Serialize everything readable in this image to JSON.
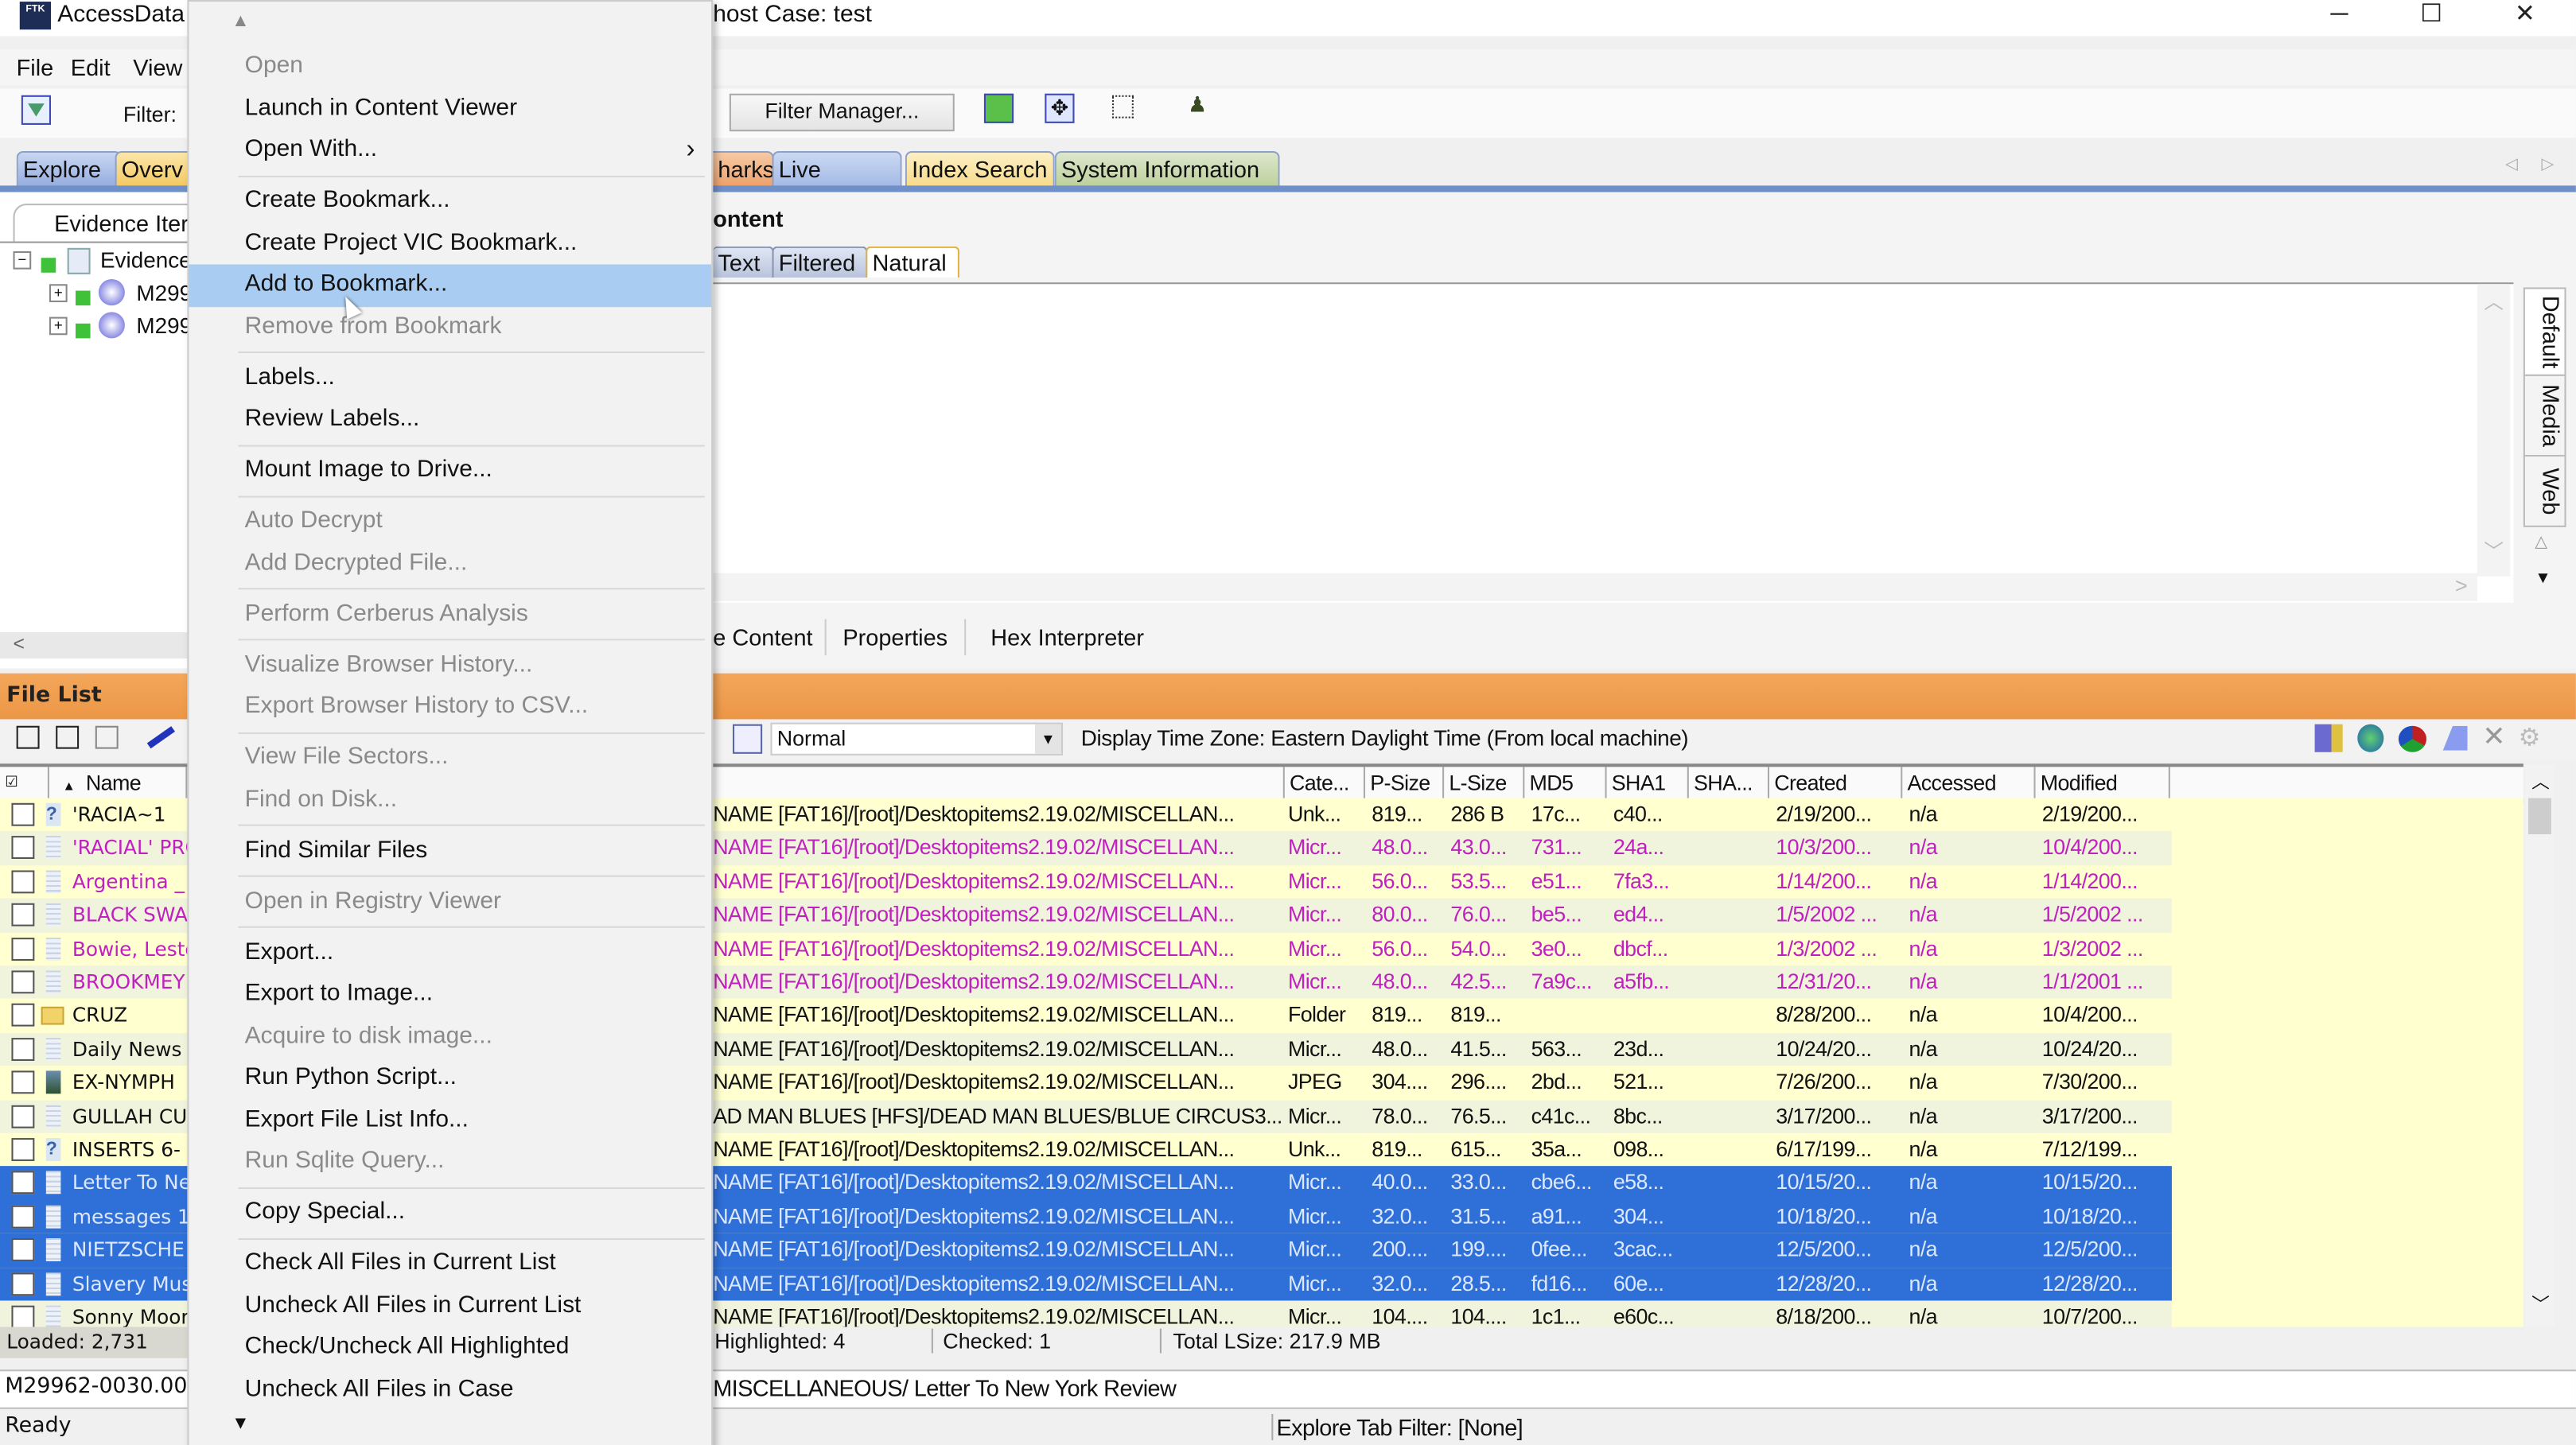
{
  "window": {
    "app_title": "AccessData",
    "case_title": "host Case: test",
    "minimize": "─",
    "maximize": "☐",
    "close": "✕"
  },
  "menubar": {
    "file": "File",
    "edit": "Edit",
    "view": "View"
  },
  "toolbar": {
    "filter_label": "Filter:",
    "filter_manager": "Filter Manager..."
  },
  "main_tabs": [
    {
      "label": "Explore",
      "color": "#a9bde6"
    },
    {
      "label": "Overv",
      "color": "#f7d680"
    },
    {
      "label": "harks",
      "color": "#f0b383"
    },
    {
      "label": "Live Search",
      "color": "#b3c6ea"
    },
    {
      "label": "Index Search",
      "color": "#f9e3a0"
    },
    {
      "label": "System Information",
      "color": "#c9d8ae"
    }
  ],
  "left_pane": {
    "tab": "Evidence Iter",
    "tree": [
      {
        "label": "Evidence"
      },
      {
        "label": "M299"
      },
      {
        "label": "M299"
      }
    ]
  },
  "content_pane": {
    "title": "ontent",
    "subtabs": [
      "Text",
      "Filtered",
      "Natural"
    ],
    "side_tabs": [
      "Default",
      "Media",
      "Web"
    ],
    "bottom_tabs": [
      "e Content",
      "Properties",
      "Hex Interpreter"
    ]
  },
  "file_list": {
    "title": "File List",
    "view_select": "Normal",
    "timezone": "Display Time Zone: Eastern Daylight Time  (From local machine)",
    "columns": {
      "name": "Name",
      "cat": "Cate...",
      "psize": "P-Size",
      "lsize": "L-Size",
      "md5": "MD5",
      "sha1": "SHA1",
      "sha": "SHA...",
      "created": "Created",
      "accessed": "Accessed",
      "modified": "Modified"
    },
    "rows": [
      {
        "name": "'RACIA~1",
        "icon": "unknown",
        "color": "black",
        "path": "NAME [FAT16]/[root]/Desktopitems2.19.02/MISCELLAN...",
        "cat": "Unk...",
        "psize": "819...",
        "lsize": "286 B",
        "md5": "17c...",
        "sha1": "c40...",
        "created": "2/19/200...",
        "accessed": "n/a",
        "modified": "2/19/200..."
      },
      {
        "name": "'RACIAL' PRO",
        "icon": "doc",
        "color": "magenta",
        "path": "NAME [FAT16]/[root]/Desktopitems2.19.02/MISCELLAN...",
        "cat": "Micr...",
        "psize": "48.0...",
        "lsize": "43.0...",
        "md5": "731...",
        "sha1": "24a...",
        "created": "10/3/200...",
        "accessed": "n/a",
        "modified": "10/4/200..."
      },
      {
        "name": "Argentina _",
        "icon": "doc",
        "color": "magenta",
        "path": "NAME [FAT16]/[root]/Desktopitems2.19.02/MISCELLAN...",
        "cat": "Micr...",
        "psize": "56.0...",
        "lsize": "53.5...",
        "md5": "e51...",
        "sha1": "7fa3...",
        "created": "1/14/200...",
        "accessed": "n/a",
        "modified": "1/14/200..."
      },
      {
        "name": "BLACK SWA",
        "icon": "doc",
        "color": "magenta",
        "path": "NAME [FAT16]/[root]/Desktopitems2.19.02/MISCELLAN...",
        "cat": "Micr...",
        "psize": "80.0...",
        "lsize": "76.0...",
        "md5": "be5...",
        "sha1": "ed4...",
        "created": "1/5/2002 ...",
        "accessed": "n/a",
        "modified": "1/5/2002 ..."
      },
      {
        "name": "Bowie, Leste",
        "icon": "doc",
        "color": "magenta",
        "path": "NAME [FAT16]/[root]/Desktopitems2.19.02/MISCELLAN...",
        "cat": "Micr...",
        "psize": "56.0...",
        "lsize": "54.0...",
        "md5": "3e0...",
        "sha1": "dbcf...",
        "created": "1/3/2002 ...",
        "accessed": "n/a",
        "modified": "1/3/2002 ..."
      },
      {
        "name": "BROOKMEY",
        "icon": "doc",
        "color": "magenta",
        "path": "NAME [FAT16]/[root]/Desktopitems2.19.02/MISCELLAN...",
        "cat": "Micr...",
        "psize": "48.0...",
        "lsize": "42.5...",
        "md5": "7a9c...",
        "sha1": "a5fb...",
        "created": "12/31/20...",
        "accessed": "n/a",
        "modified": "1/1/2001 ..."
      },
      {
        "name": "CRUZ",
        "icon": "folder",
        "color": "black",
        "path": "NAME [FAT16]/[root]/Desktopitems2.19.02/MISCELLAN...",
        "cat": "Folder",
        "psize": "819...",
        "lsize": "819...",
        "md5": "",
        "sha1": "",
        "created": "8/28/200...",
        "accessed": "n/a",
        "modified": "10/4/200..."
      },
      {
        "name": "Daily News",
        "icon": "doc",
        "color": "black",
        "path": "NAME [FAT16]/[root]/Desktopitems2.19.02/MISCELLAN...",
        "cat": "Micr...",
        "psize": "48.0...",
        "lsize": "41.5...",
        "md5": "563...",
        "sha1": "23d...",
        "created": "10/24/20...",
        "accessed": "n/a",
        "modified": "10/24/20..."
      },
      {
        "name": "EX-NYMPH",
        "icon": "image",
        "color": "black",
        "path": "NAME [FAT16]/[root]/Desktopitems2.19.02/MISCELLAN...",
        "cat": "JPEG",
        "psize": "304....",
        "lsize": "296....",
        "md5": "2bd...",
        "sha1": "521...",
        "created": "7/26/200...",
        "accessed": "n/a",
        "modified": "7/30/200..."
      },
      {
        "name": "GULLAH CU",
        "icon": "doc",
        "color": "black",
        "path": "AD MAN BLUES [HFS]/DEAD MAN BLUES/BLUE CIRCUS3...",
        "cat": "Micr...",
        "psize": "78.0...",
        "lsize": "76.5...",
        "md5": "c41c...",
        "sha1": "8bc...",
        "created": "3/17/200...",
        "accessed": "n/a",
        "modified": "3/17/200..."
      },
      {
        "name": "INSERTS 6-",
        "icon": "unknown",
        "color": "black",
        "path": "NAME [FAT16]/[root]/Desktopitems2.19.02/MISCELLAN...",
        "cat": "Unk...",
        "psize": "819...",
        "lsize": "615...",
        "md5": "35a...",
        "sha1": "098...",
        "created": "6/17/199...",
        "accessed": "n/a",
        "modified": "7/12/199..."
      },
      {
        "name": "Letter To Ne",
        "icon": "doc",
        "color": "selected",
        "path": "NAME [FAT16]/[root]/Desktopitems2.19.02/MISCELLAN...",
        "cat": "Micr...",
        "psize": "40.0...",
        "lsize": "33.0...",
        "md5": "cbe6...",
        "sha1": "e58...",
        "created": "10/15/20...",
        "accessed": "n/a",
        "modified": "10/15/20..."
      },
      {
        "name": "messages 1",
        "icon": "doc",
        "color": "selected",
        "path": "NAME [FAT16]/[root]/Desktopitems2.19.02/MISCELLAN...",
        "cat": "Micr...",
        "psize": "32.0...",
        "lsize": "31.5...",
        "md5": "a91...",
        "sha1": "304...",
        "created": "10/18/20...",
        "accessed": "n/a",
        "modified": "10/18/20..."
      },
      {
        "name": "NIETZSCHE",
        "icon": "doc",
        "color": "selected",
        "path": "NAME [FAT16]/[root]/Desktopitems2.19.02/MISCELLAN...",
        "cat": "Micr...",
        "psize": "200....",
        "lsize": "199....",
        "md5": "0fee...",
        "sha1": "3cac...",
        "created": "12/5/200...",
        "accessed": "n/a",
        "modified": "12/5/200..."
      },
      {
        "name": "Slavery Mus",
        "icon": "doc",
        "color": "selected",
        "path": "NAME [FAT16]/[root]/Desktopitems2.19.02/MISCELLAN...",
        "cat": "Micr...",
        "psize": "32.0...",
        "lsize": "28.5...",
        "md5": "fd16...",
        "sha1": "60e...",
        "created": "12/28/20...",
        "accessed": "n/a",
        "modified": "12/28/20..."
      },
      {
        "name": "Sonny Moor",
        "icon": "doc",
        "color": "black",
        "path": "NAME [FAT16]/[root]/Desktopitems2.19.02/MISCELLAN...",
        "cat": "Micr...",
        "psize": "104....",
        "lsize": "104....",
        "md5": "1c1...",
        "sha1": "e60c...",
        "created": "8/18/200...",
        "accessed": "n/a",
        "modified": "10/7/200..."
      }
    ],
    "status": {
      "loaded": "Loaded: 2,731",
      "highlighted": "Highlighted: 4",
      "checked": "Checked: 1",
      "total": "Total LSize: 217.9 MB"
    },
    "path_left": "M29962-0030.00",
    "path_right": "MISCELLANEOUS/ Letter To New York Review"
  },
  "statusbar": {
    "ready": "Ready",
    "filter": "Explore Tab Filter: [None]"
  },
  "colors": {
    "magenta": "#c020c0",
    "selected_bg": "#2f6fd8",
    "selected_text": "#dce8ff",
    "highlight": "#a9cdf2",
    "orange": "#ee9a4c"
  },
  "context_menu": {
    "items": [
      {
        "label": "Open",
        "disabled": true
      },
      {
        "label": "Launch in Content Viewer"
      },
      {
        "label": "Open With...",
        "submenu": true
      },
      {
        "sep": true
      },
      {
        "label": "Create Bookmark..."
      },
      {
        "label": "Create Project VIC Bookmark..."
      },
      {
        "label": "Add to Bookmark...",
        "highlighted": true
      },
      {
        "label": "Remove from Bookmark",
        "disabled": true
      },
      {
        "sep": true
      },
      {
        "label": "Labels..."
      },
      {
        "label": "Review Labels..."
      },
      {
        "sep": true
      },
      {
        "label": "Mount Image to Drive..."
      },
      {
        "sep": true
      },
      {
        "label": "Auto Decrypt",
        "disabled": true
      },
      {
        "label": "Add Decrypted File...",
        "disabled": true
      },
      {
        "sep": true
      },
      {
        "label": "Perform Cerberus Analysis",
        "disabled": true
      },
      {
        "sep": true
      },
      {
        "label": "Visualize Browser History...",
        "disabled": true
      },
      {
        "label": "Export Browser History to CSV...",
        "disabled": true
      },
      {
        "sep": true
      },
      {
        "label": "View File Sectors...",
        "disabled": true
      },
      {
        "label": "Find on Disk...",
        "disabled": true
      },
      {
        "sep": true
      },
      {
        "label": "Find Similar Files"
      },
      {
        "sep": true
      },
      {
        "label": "Open in Registry Viewer",
        "disabled": true
      },
      {
        "sep": true
      },
      {
        "label": "Export..."
      },
      {
        "label": "Export to Image..."
      },
      {
        "label": "Acquire to disk image...",
        "disabled": true
      },
      {
        "label": "Run Python Script..."
      },
      {
        "label": "Export File List Info..."
      },
      {
        "label": "Run Sqlite Query...",
        "disabled": true
      },
      {
        "sep": true
      },
      {
        "label": "Copy Special..."
      },
      {
        "sep": true
      },
      {
        "label": "Check All Files in Current List"
      },
      {
        "label": "Uncheck All Files in Current List"
      },
      {
        "label": "Check/Uncheck All Highlighted"
      },
      {
        "label": "Uncheck All Files in Case"
      }
    ]
  }
}
